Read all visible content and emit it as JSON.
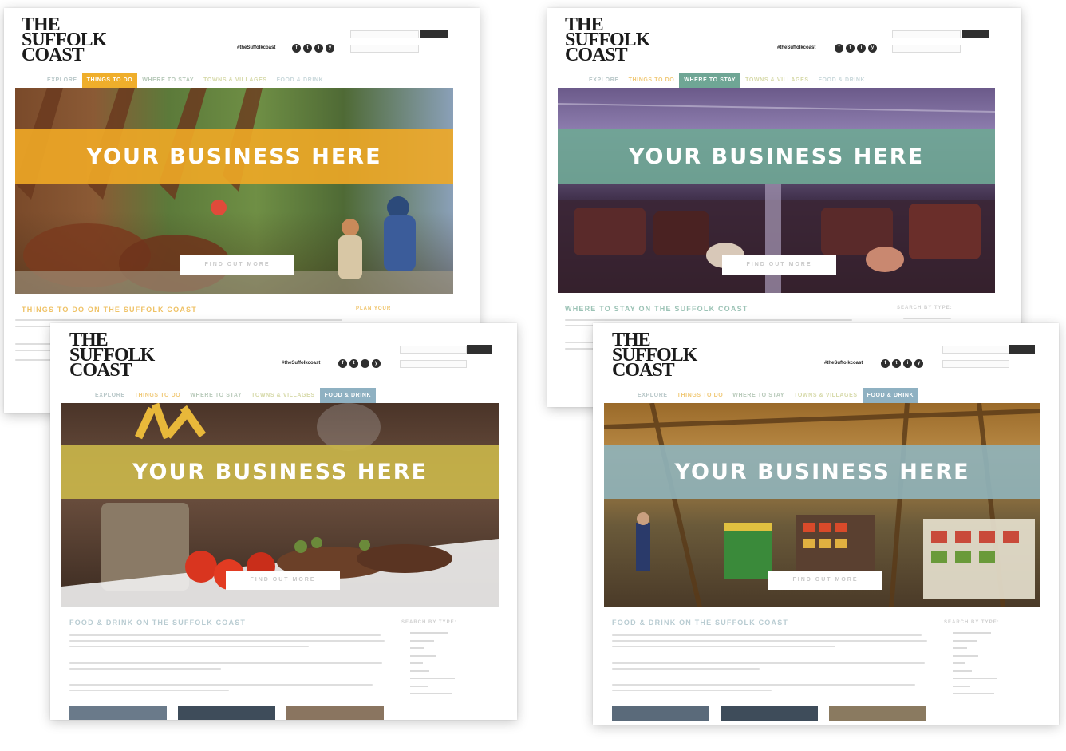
{
  "logo": {
    "line1": "THE",
    "line2": "SUFFOLK",
    "line3": "COAST"
  },
  "hashtag": "#theSuffolkcoast",
  "social_icons": [
    "facebook-icon",
    "twitter-icon",
    "instagram-icon",
    "youtube-icon"
  ],
  "social_glyphs": [
    "f",
    "t",
    "i",
    "y"
  ],
  "banner_text": "YOUR BUSINESS HERE",
  "cta_label": "FIND OUT MORE",
  "nav_tabs": [
    "EXPLORE",
    "THINGS TO DO",
    "WHERE TO STAY",
    "TOWNS & VILLAGES",
    "FOOD & DRINK"
  ],
  "mockups": [
    {
      "name": "things-to-do",
      "accent": "#efae2b",
      "active_tab": 1,
      "section_title": "THINGS TO DO ON THE SUFFOLK COAST",
      "side_title": "PLAN YOUR"
    },
    {
      "name": "where-to-stay",
      "accent": "#6fa695",
      "active_tab": 2,
      "section_title": "WHERE TO STAY ON THE SUFFOLK COAST",
      "side_title": "SEARCH BY TYPE:"
    },
    {
      "name": "food-and-drink-restaurant",
      "accent": "#c9b54a",
      "active_tab": 4,
      "section_title": "FOOD & DRINK ON THE SUFFOLK COAST",
      "side_title": "SEARCH BY TYPE:"
    },
    {
      "name": "food-and-drink-market",
      "accent": "#8fb1b8",
      "active_tab": 4,
      "section_title": "FOOD & DRINK ON THE SUFFOLK COAST",
      "side_title": "SEARCH BY TYPE:"
    }
  ],
  "colors": {
    "nav_text": "#b7c9b9",
    "dark": "#2f2f2f"
  }
}
